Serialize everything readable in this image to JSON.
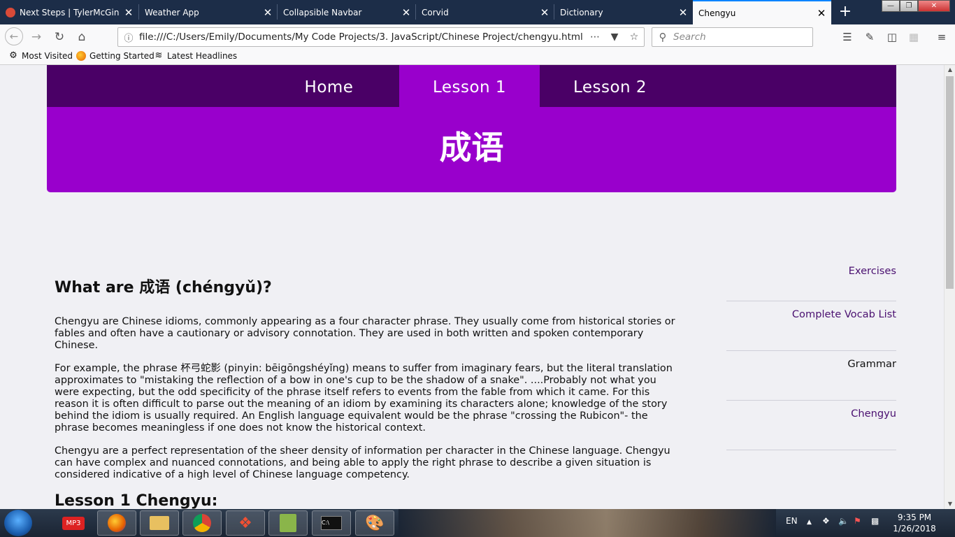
{
  "browser": {
    "tabs": [
      {
        "title": "Next Steps | TylerMcGinnis",
        "active": false
      },
      {
        "title": "Weather App",
        "active": false
      },
      {
        "title": "Collapsible Navbar",
        "active": false
      },
      {
        "title": "Corvid",
        "active": false
      },
      {
        "title": "Dictionary",
        "active": false
      },
      {
        "title": "Chengyu",
        "active": true
      }
    ],
    "close_glyph": "✕",
    "new_tab_glyph": "+",
    "url": "file:///C:/Users/Emily/Documents/My Code Projects/3. JavaScript/Chinese Project/chengyu.html",
    "search_placeholder": "Search",
    "bookmarks": [
      "Most Visited",
      "Getting Started",
      "Latest Headlines"
    ]
  },
  "page": {
    "nav": {
      "home": "Home",
      "lesson1": "Lesson 1",
      "lesson2": "Lesson 2"
    },
    "title": "成语",
    "heading": "What are 成语 (chéngyǔ)?",
    "paragraphs": [
      "Chengyu are Chinese idioms, commonly appearing as a four character phrase. They usually come from historical stories or fables and often have a cautionary or advisory connotation. They are used in both written and spoken contemporary Chinese.",
      "For example, the phrase 杯弓蛇影 (pinyin: bēigōngshéyǐng) means to suffer from imaginary fears, but the literal translation approximates to \"mistaking the reflection of a bow in one's cup to be the shadow of a snake\". ....Probably not what you were expecting, but the odd specificity of the phrase itself refers to events from the fable from which it came. For this reason it is often difficult to parse out the meaning of an idiom by examining its characters alone; knowledge of the story behind the idiom is usually required. An English language equivalent would be the phrase \"crossing the Rubicon\"- the phrase becomes meaningless if one does not know the historical context.",
      "Chengyu are a perfect representation of the sheer density of information per character in the Chinese language. Chengyu can have complex and nuanced connotations, and being able to apply the right phrase to describe a given situation is considered indicative of a high level of Chinese language competency."
    ],
    "subheading": "Lesson 1 Chengyu:",
    "sidebar": [
      "Exercises",
      "Complete Vocab List",
      "Grammar",
      "Chengyu"
    ],
    "colors": {
      "nav_dark": "#4a0066",
      "accent": "#9900cc",
      "link": "#4a1070"
    }
  },
  "taskbar": {
    "language": "EN",
    "time": "9:35 PM",
    "date": "1/26/2018"
  }
}
